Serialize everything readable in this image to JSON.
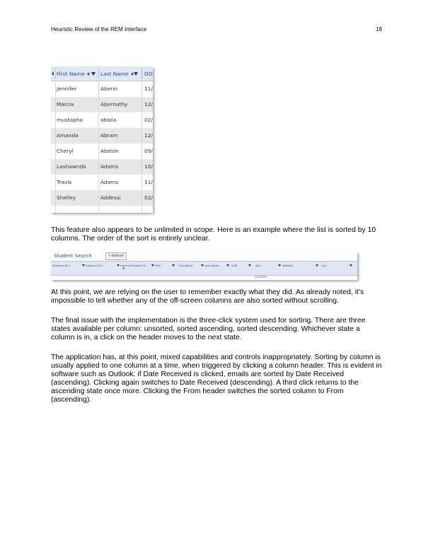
{
  "header": {
    "title": "Heuristic Review of the REM Interface",
    "page_number": "18"
  },
  "figure1": {
    "columns": [
      "First Name",
      "Last Name",
      "DO"
    ],
    "rows": [
      {
        "first": "Jennifer",
        "last": "Aberin",
        "dob": "11/"
      },
      {
        "first": "Marcia",
        "last": "Abernathy",
        "dob": "12/"
      },
      {
        "first": "mustapha",
        "last": "abiola",
        "dob": "02/"
      },
      {
        "first": "Amanda",
        "last": "Abram",
        "dob": "12/"
      },
      {
        "first": "Cheryl",
        "last": "Abston",
        "dob": "09/"
      },
      {
        "first": "Lashawnda",
        "last": "Adams",
        "dob": "10/"
      },
      {
        "first": "Travis",
        "last": "Adams",
        "dob": "11/"
      },
      {
        "first": "Shelley",
        "last": "Addessi",
        "dob": "02/"
      }
    ]
  },
  "paragraph1": "This feature also appears to be unlimited in scope. Here is an example where the list is sorted by 10 columns. The order of the sort is entirely unclear.",
  "figure2": {
    "title": "Student Search",
    "refresh_label": "Refresh",
    "columns": [
      "External ID 1",
      "External ID 2",
      "Internal Student ID",
      "SSN",
      "First Name",
      "Last Name",
      "DOB",
      "Site",
      "Address",
      "City"
    ],
    "dropdown_hint": "Contains"
  },
  "paragraph2": "At this point, we are relying on the user to remember exactly what they did. As already noted, it’s impossible to tell whether any of the off-screen columns are also sorted without scrolling.",
  "paragraph3": "The final issue with the implementation is the three-click system used for sorting. There are three states available per column: unsorted, sorted ascending, sorted descending. Whichever state a column is in, a click on the header moves to the next state.",
  "paragraph4": "The application has, at this point, mixed capabilities and controls inappropriately. Sorting by column is usually applied to one column at a time, when triggered by clicking a column header. This is evident in software such as Outlook: if Date Received is clicked, emails are sorted by Date Received (ascending). Clicking again switches to Date Received (descending). A third click returns to the ascending state once more. Clicking the From header switches the sorted column to From (ascending)."
}
